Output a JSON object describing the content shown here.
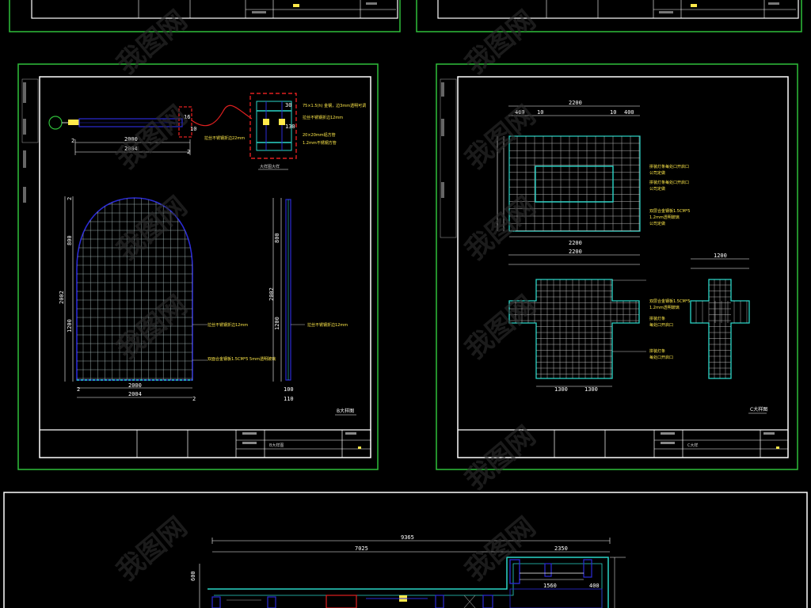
{
  "sheet_left": {
    "top_dims": [
      "2000",
      "2004"
    ],
    "top_dim_ends": [
      "2",
      "2"
    ],
    "top_note": "拉丝不锈钢折边22mm",
    "detail_notes": [
      "75×1.5(h) 金钢，边3mm透明可调",
      "拉丝不锈钢折边12mm",
      "20×20mm铝方管",
      "1.2mm不锈钢方管"
    ],
    "detail_label": "大样图大样",
    "arch_dims_vertical": [
      "800",
      "2002",
      "1200"
    ],
    "arch_top_dim": "2",
    "arch_bottom_dims": [
      "2000",
      "2004"
    ],
    "arch_bottom_ends": [
      "2",
      "2"
    ],
    "arch_notes": [
      "拉丝不锈钢折边12mm",
      "双面合金钢板1.5CM*5 5mm透明玻璃"
    ],
    "side_dims_vertical": [
      "800",
      "2002",
      "1200"
    ],
    "side_bottom_dims": [
      "100",
      "110"
    ],
    "side_note": "拉丝不锈钢折边12mm",
    "sheet_tag": "B大样图",
    "titleblock_title": "B大样图"
  },
  "sheet_right": {
    "top_grid_dims": [
      "2200",
      "2200"
    ],
    "top_grid_notes": [
      "拼装灯条每处口开启口",
      "公司定做",
      "拼装灯条每处口开启口",
      "公司定做",
      "双层合金钢板1.5CM*5",
      "1.2mm透明玻璃",
      "公司定做"
    ],
    "cross_dims": [
      "2200",
      "1200"
    ],
    "cross_notes": [
      "双层合金钢板1.5CM*5",
      "1.2mm透明玻璃",
      "拼装灯条",
      "每处口开启口",
      "拼装灯条",
      "每处口开启口"
    ],
    "small_cross_dims": [
      "1200"
    ],
    "bottom_dims": [
      "1300",
      "1300"
    ],
    "sheet_tag": "C大样图",
    "titleblock_title": "C大样"
  },
  "plan": {
    "dim_total": "9365",
    "dim_left": "7025",
    "dim_right": "2350",
    "dim_inner": "1560",
    "dim_side": "400",
    "dim_left_vertical": "600"
  },
  "watermark": {
    "text": "我图网"
  },
  "colors": {
    "frame_green": "#2fbf3a",
    "paper_white": "#ffffff",
    "grid_blue": "#2b2bd6",
    "grid_cyan": "#2ad6c8",
    "accent_red": "#e02020",
    "accent_yellow": "#ffe94a"
  }
}
